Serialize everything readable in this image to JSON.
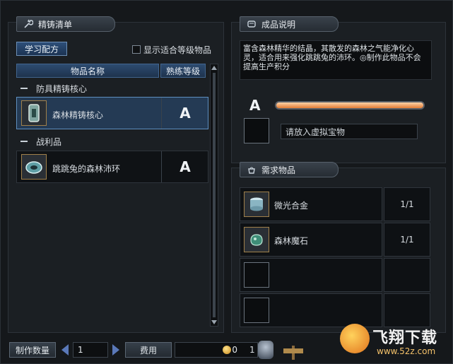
{
  "left_panel": {
    "title": "精铸清单",
    "title_icon": "wrench-icon",
    "learn_button": "学习配方",
    "show_filter_label": "显示适合等级物品",
    "columns": [
      "物品名称",
      "熟练等级"
    ],
    "groups": [
      {
        "label": "防具精铸核心",
        "items": [
          {
            "name": "森林精铸核心",
            "rank": "A",
            "selected": true,
            "icon": "green-core-icon"
          }
        ]
      },
      {
        "label": "战利品",
        "items": [
          {
            "name": "跳跳兔的森林沛环",
            "rank": "A",
            "selected": false,
            "icon": "green-ring-icon"
          }
        ]
      }
    ]
  },
  "right_top": {
    "title": "成品说明",
    "title_icon": "scroll-icon",
    "description": "富含森林精华的结晶，其散发的森林之气能净化心灵，适合用来强化跳跳兔的沛环。◎制作此物品不会提高生产积分",
    "rank": "A",
    "slot_placeholder": "请放入虚拟宝物"
  },
  "required": {
    "title": "需求物品",
    "title_icon": "bag-icon",
    "items": [
      {
        "name": "微光合金",
        "qty": "1/1",
        "icon": "alloy-icon"
      },
      {
        "name": "森林魔石",
        "qty": "1/1",
        "icon": "magic-stone-icon"
      },
      {
        "name": "",
        "qty": "",
        "icon": ""
      },
      {
        "name": "",
        "qty": "",
        "icon": ""
      }
    ]
  },
  "bottom": {
    "craft_count_label": "制作数量",
    "craft_count_value": "1",
    "fee_label": "费用",
    "fee_value": "0",
    "right_value": "1"
  },
  "watermark": {
    "brand": "飞翔下载",
    "url": "www.52z.com"
  },
  "colors": {
    "accent_blue": "#2d4f79",
    "selected_row": "#243a54",
    "orange_bar": "#f0a060",
    "item_border": "#a0804a"
  }
}
